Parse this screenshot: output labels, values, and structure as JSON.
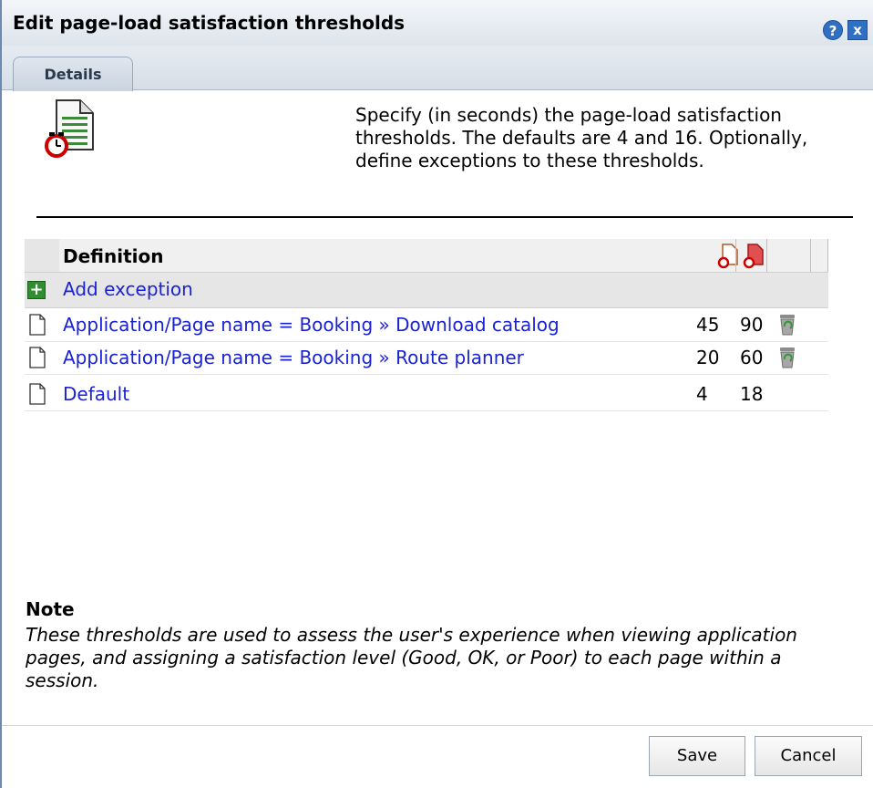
{
  "dialog": {
    "title": "Edit page-load satisfaction thresholds",
    "help_label": "?",
    "close_label": "x",
    "tab_label": "Details",
    "description": "Specify (in seconds) the page-load satisfaction thresholds. The defaults are 4 and 16. Optionally, define exceptions to these thresholds."
  },
  "grid": {
    "definition_header": "Definition",
    "add_exception_label": "Add exception",
    "rows": [
      {
        "definition": "Application/Page name = Booking » Download catalog",
        "satisfied": "45",
        "tolerating": "90",
        "deletable": true
      },
      {
        "definition": "Application/Page name = Booking » Route planner",
        "satisfied": "20",
        "tolerating": "60",
        "deletable": true
      },
      {
        "definition": "Default",
        "satisfied": "4",
        "tolerating": "18",
        "deletable": false
      }
    ]
  },
  "note": {
    "title": "Note",
    "text": "These thresholds are used to assess the user's experience when viewing application pages, and assigning a satisfaction level (Good, OK, or Poor) to each page within a session."
  },
  "buttons": {
    "save": "Save",
    "cancel": "Cancel"
  }
}
